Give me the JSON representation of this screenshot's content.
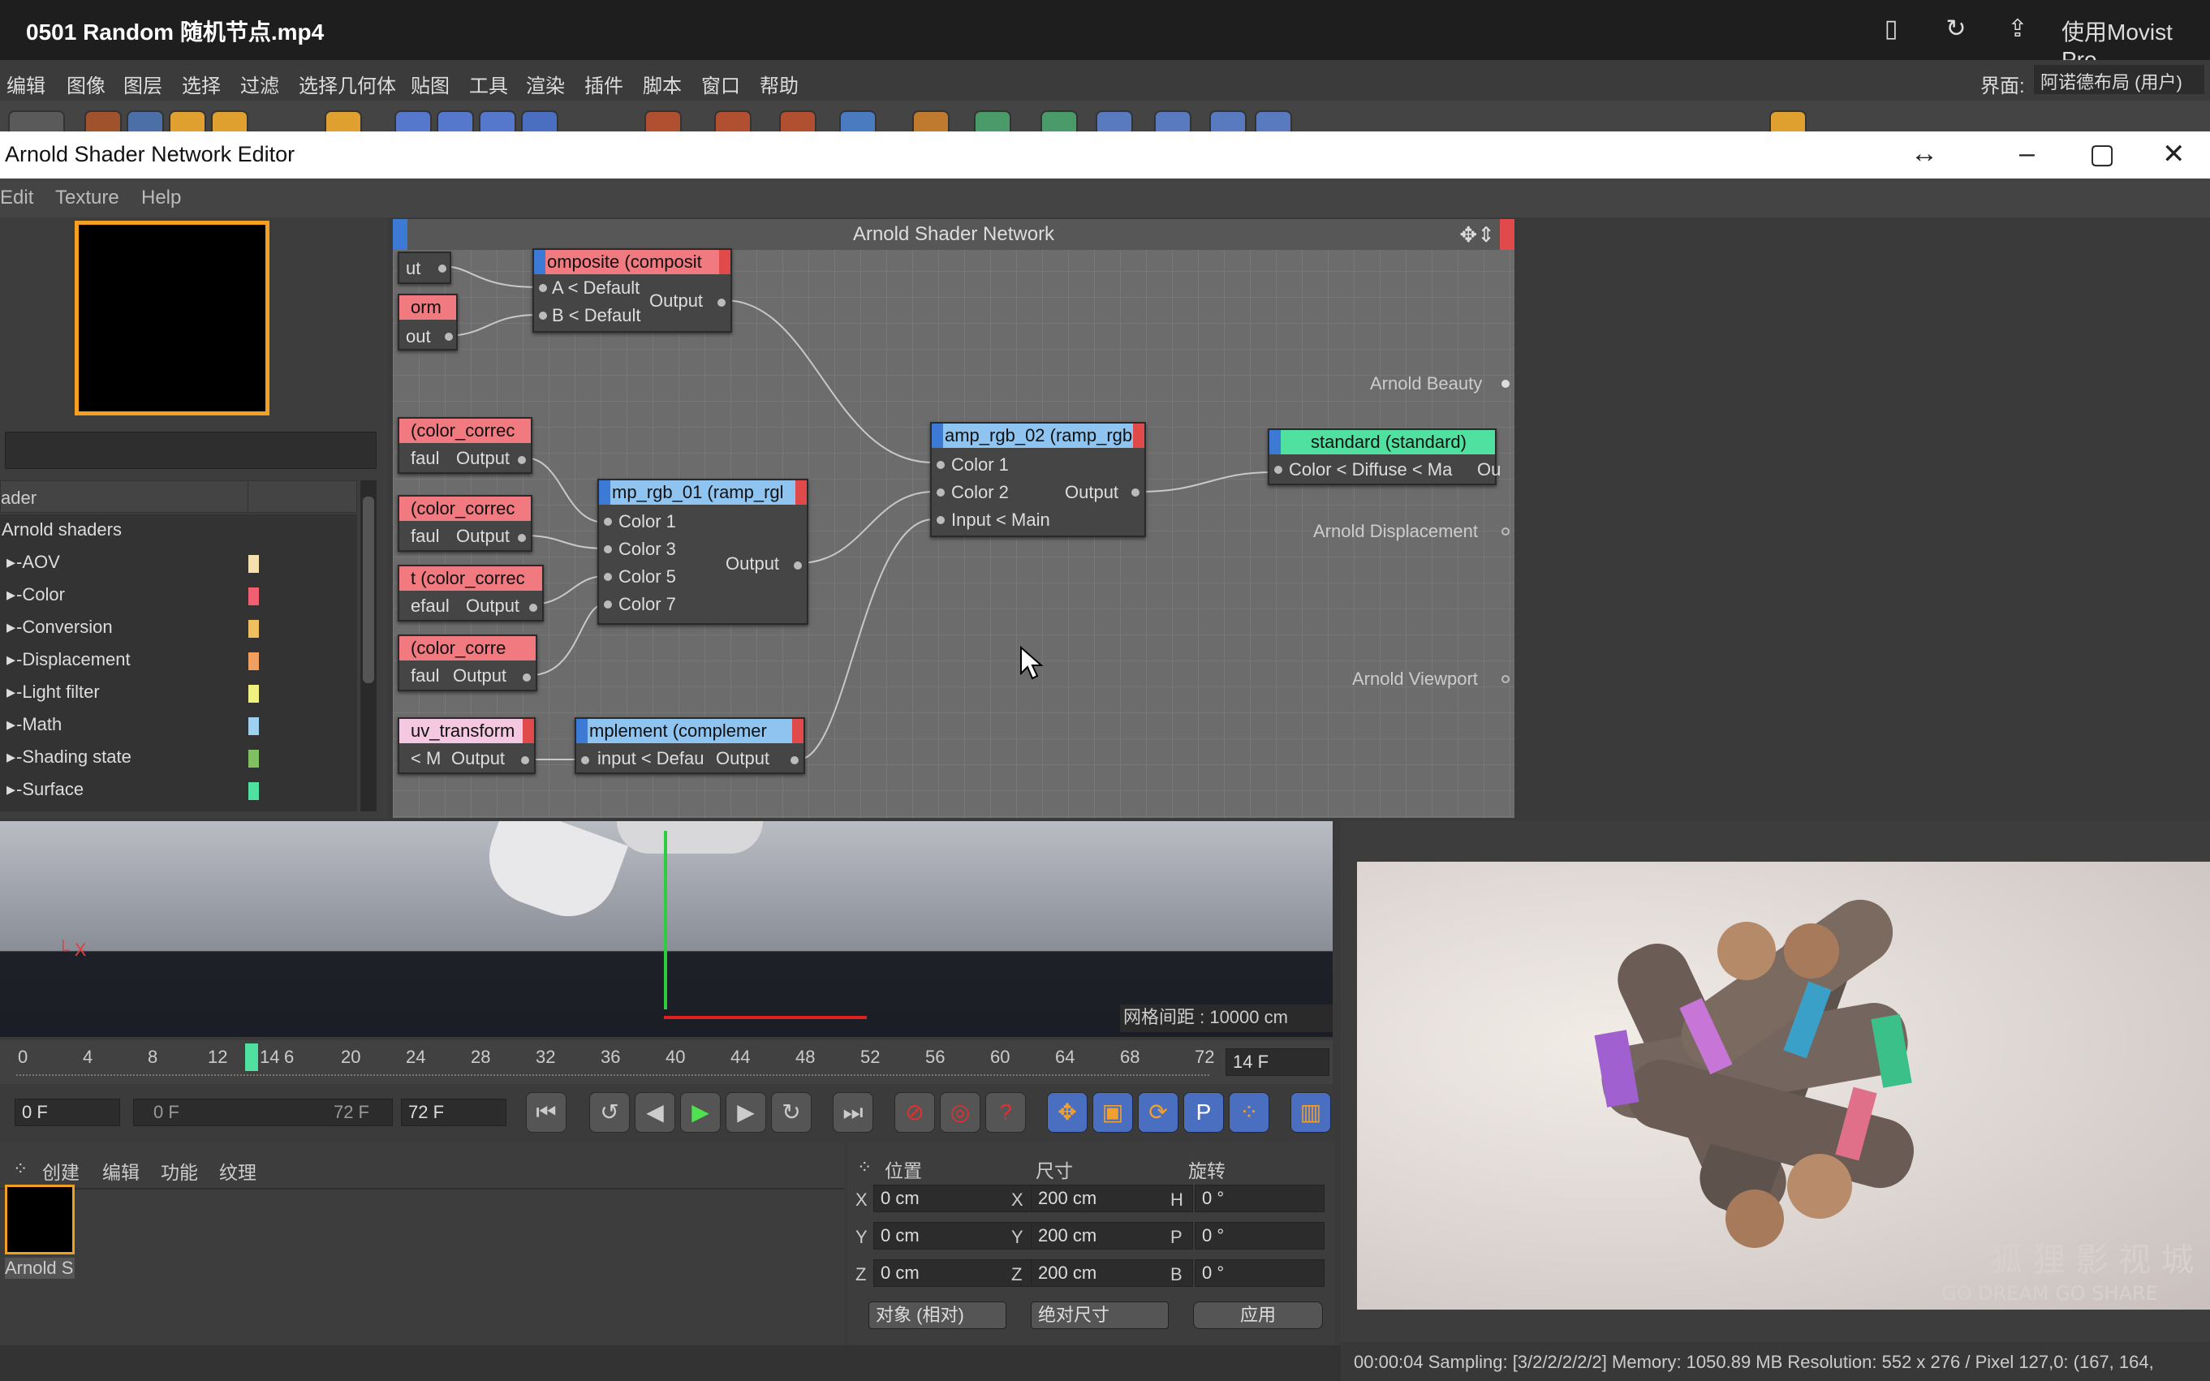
{
  "window": {
    "title": "0501 Random 随机节点.mp4",
    "movist": "使用Movist Pro"
  },
  "c4d_menu": [
    "编辑",
    "图像",
    "图层",
    "选择",
    "过滤",
    "选择几何体",
    "贴图",
    "工具",
    "渲染",
    "插件",
    "脚本",
    "窗口",
    "帮助"
  ],
  "layout": {
    "label": "界面:",
    "value": "阿诺德布局 (用户)"
  },
  "editor": {
    "title": "Arnold Shader Network Editor",
    "menu": [
      "Edit",
      "Texture",
      "Help"
    ],
    "canvas_title": "Arnold Shader Network"
  },
  "tree": {
    "header": "ader",
    "items": [
      {
        "label": "Arnold shaders",
        "color": ""
      },
      {
        "label": "-AOV",
        "color": "#f7e0b0"
      },
      {
        "label": "-Color",
        "color": "#f06070"
      },
      {
        "label": "-Conversion",
        "color": "#f0c060"
      },
      {
        "label": "-Displacement",
        "color": "#f0a060"
      },
      {
        "label": "-Light filter",
        "color": "#f0f080"
      },
      {
        "label": "-Math",
        "color": "#a0d0f0"
      },
      {
        "label": "-Shading state",
        "color": "#80c060"
      },
      {
        "label": "-Surface",
        "color": "#50e0a0"
      }
    ]
  },
  "nodes": {
    "n_ut": {
      "label": "ut",
      "ports": [
        "ut"
      ]
    },
    "composite": {
      "title": "omposite (composit",
      "inputs": [
        "A < Default",
        "B < Default"
      ],
      "output": "Output"
    },
    "orm": {
      "title": "orm",
      "out": "out"
    },
    "cc1": {
      "title": "(color_correc",
      "left": "faul",
      "output": "Output"
    },
    "cc2": {
      "title": "(color_correc",
      "left": "faul",
      "output": "Output"
    },
    "cc3": {
      "title": "t (color_correc",
      "left": "efaul",
      "output": "Output"
    },
    "cc4": {
      "title": "(color_corre",
      "left": "faul",
      "output": "Output"
    },
    "ramp01": {
      "title": "mp_rgb_01 (ramp_rgl",
      "inputs": [
        "Color 1",
        "Color 3",
        "Color 5",
        "Color 7"
      ],
      "output": "Output"
    },
    "ramp02": {
      "title": "amp_rgb_02 (ramp_rgb",
      "inputs": [
        "Color 1",
        "Color 2",
        "Input < Main"
      ],
      "output": "Output"
    },
    "standard": {
      "title": "standard (standard)",
      "input": "Color < Diffuse < Ma",
      "output": "Ou"
    },
    "uv": {
      "title": "uv_transform",
      "left": "< M",
      "output": "Output"
    },
    "complement": {
      "title": "mplement (complemer",
      "input": "input < Defau",
      "output": "Output"
    }
  },
  "slots": [
    "Arnold Beauty",
    "Arnold Displacement",
    "Arnold Viewport"
  ],
  "viewport": {
    "grid_spacing": "网格间距 : 10000 cm"
  },
  "timeline": {
    "ticks": [
      "0",
      "4",
      "8",
      "12",
      "14",
      "6",
      "20",
      "24",
      "28",
      "32",
      "36",
      "40",
      "44",
      "48",
      "52",
      "56",
      "60",
      "64",
      "68",
      "72"
    ],
    "current": "14 F"
  },
  "controls": {
    "start": "0 F",
    "range_start": "0 F",
    "range_end": "72 F",
    "end": "72 F"
  },
  "material_panel": {
    "menu": [
      "创建",
      "编辑",
      "功能",
      "纹理"
    ],
    "mat_label": "Arnold S"
  },
  "coords": {
    "headers": [
      "位置",
      "尺寸",
      "旋转"
    ],
    "rows": [
      {
        "a": "X",
        "av": "0 cm",
        "b": "X",
        "bv": "200 cm",
        "c": "H",
        "cv": "0 °"
      },
      {
        "a": "Y",
        "av": "0 cm",
        "b": "Y",
        "bv": "200 cm",
        "c": "P",
        "cv": "0 °"
      },
      {
        "a": "Z",
        "av": "0 cm",
        "b": "Z",
        "bv": "200 cm",
        "c": "B",
        "cv": "0 °"
      }
    ],
    "mode1": "对象 (相对)",
    "mode2": "绝对尺寸",
    "apply": "应用"
  },
  "render": {
    "status": "00:00:04  Sampling: [3/2/2/2/2/2]  Memory: 1050.89 MB  Resolution: 552 x 276 / Pixel 127,0: (167, 164,",
    "watermark": "狐 狸 影 视 城",
    "watermark_sub": "GO DREAM GO SHARE"
  }
}
